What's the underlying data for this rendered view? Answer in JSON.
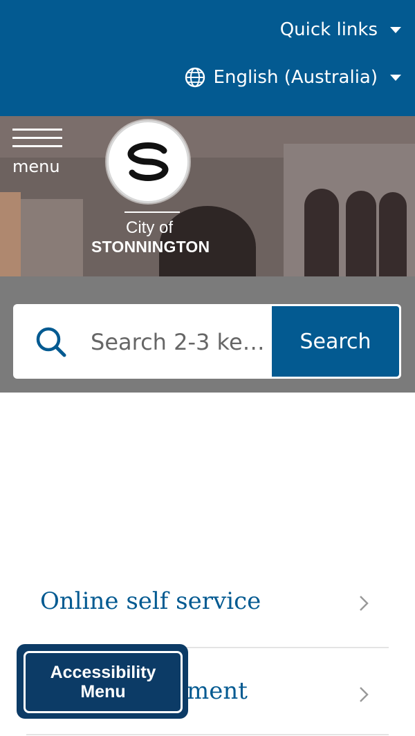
{
  "header": {
    "quick_links_label": "Quick links",
    "language_label": "English (Australia)"
  },
  "hero": {
    "menu_label": "menu",
    "logo_city_text": "City of",
    "logo_name_text": "STONNINGTON"
  },
  "search": {
    "placeholder": "Search 2-3 ke…",
    "button_label": "Search"
  },
  "links": [
    {
      "label": "Online self service"
    },
    {
      "label": "ment"
    }
  ],
  "accessibility": {
    "label_line1": "Accessibility",
    "label_line2": "Menu"
  },
  "colors": {
    "brand_blue": "#035a91",
    "accessibility_navy": "#0c3b66"
  }
}
